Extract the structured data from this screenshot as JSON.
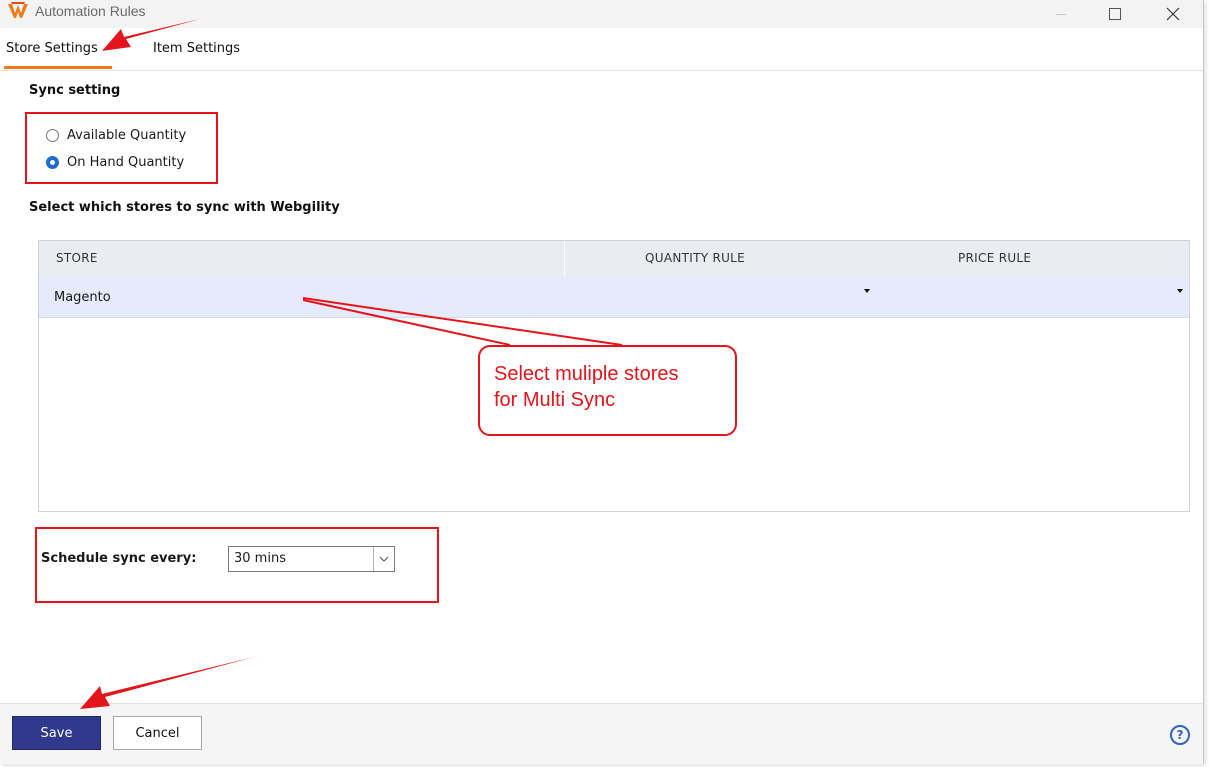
{
  "window": {
    "title": "Automation Rules"
  },
  "tabs": [
    {
      "label": "Store Settings",
      "active": true
    },
    {
      "label": "Item Settings",
      "active": false
    }
  ],
  "sync": {
    "heading": "Sync setting",
    "options": [
      {
        "label": "Available Quantity",
        "selected": false
      },
      {
        "label": "On Hand Quantity",
        "selected": true
      }
    ]
  },
  "stores": {
    "heading": "Select which stores to sync with Webgility",
    "columns": [
      "STORE",
      "QUANTITY RULE",
      "PRICE RULE"
    ],
    "rows": [
      {
        "store": "Magento",
        "quantity_rule": "",
        "price_rule": ""
      }
    ]
  },
  "schedule": {
    "label": "Schedule sync every:",
    "value": "30 mins"
  },
  "buttons": {
    "save": "Save",
    "cancel": "Cancel"
  },
  "help_icon": "question-circle-icon",
  "annotation": {
    "callout_text": "Select muliple stores\nfor Multi Sync",
    "color": "#e3141b"
  },
  "colors": {
    "accent_tab": "#f07b1c",
    "save_button": "#2f3a8f",
    "radio_selected": "#1e6bd6",
    "row_selected": "#e6ebfb"
  }
}
